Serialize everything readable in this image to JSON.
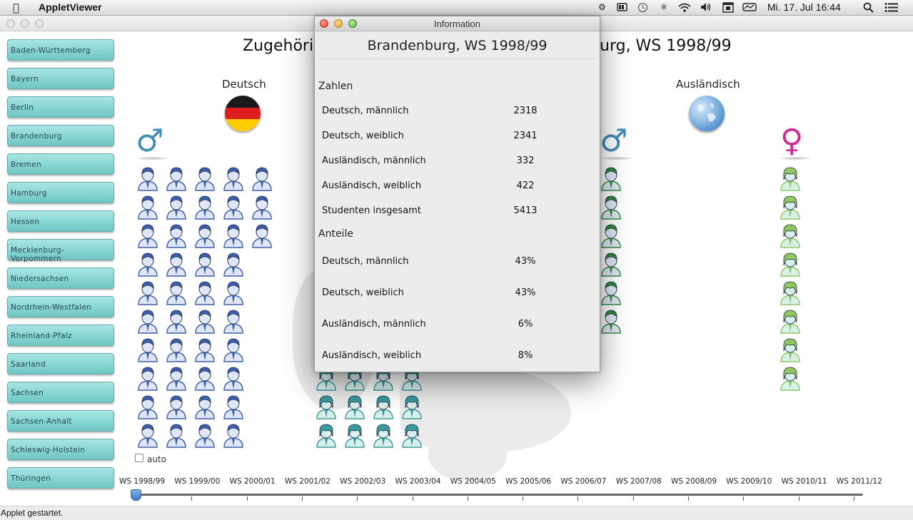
{
  "menubar": {
    "app_name": "AppletViewer",
    "clock": "Mi. 17. Jul  16:44"
  },
  "sidebar": {
    "items": [
      {
        "label": "Baden-Württemberg"
      },
      {
        "label": "Bayern"
      },
      {
        "label": "Berlin"
      },
      {
        "label": "Brandenburg"
      },
      {
        "label": "Bremen"
      },
      {
        "label": "Hamburg"
      },
      {
        "label": "Hessen"
      },
      {
        "label": "Mecklenburg-Vorpommern"
      },
      {
        "label": "Niedersachsen"
      },
      {
        "label": "Nordrhein-Westfalen"
      },
      {
        "label": "Rheinland-Pfalz"
      },
      {
        "label": "Saarland"
      },
      {
        "label": "Sachsen"
      },
      {
        "label": "Sachsen-Anhalt"
      },
      {
        "label": "Schleswig-Holstein"
      },
      {
        "label": "Thüringen"
      }
    ]
  },
  "main": {
    "title_left": "Zugehörig",
    "title_right": "urg, WS 1998/99",
    "col_deutsch": "Deutsch",
    "col_auslaendisch": "Ausländisch",
    "auto_label": "auto",
    "colors": {
      "de_male": "#3d5fae",
      "de_female": "#3a9a9c",
      "aus_male": "#2e8a3a",
      "aus_female": "#8fc860"
    }
  },
  "timeline": {
    "years": [
      "WS 1998/99",
      "WS 1999/00",
      "WS 2000/01",
      "WS 2001/02",
      "WS 2002/03",
      "WS 2003/04",
      "WS 2004/05",
      "WS 2005/06",
      "WS 2006/07",
      "WS 2007/08",
      "WS 2008/09",
      "WS 2009/10",
      "WS 2010/11",
      "WS 2011/12"
    ],
    "selected": "WS 1998/99"
  },
  "status": "Applet gestartet.",
  "dialog": {
    "title": "Information",
    "heading": "Brandenburg, WS 1998/99",
    "section_numbers": "Zahlen",
    "section_shares": "Anteile",
    "numbers": [
      {
        "label": "Deutsch, männlich",
        "value": "2318"
      },
      {
        "label": "Deutsch, weiblich",
        "value": "2341"
      },
      {
        "label": "Ausländisch, männlich",
        "value": "332"
      },
      {
        "label": "Ausländisch, weiblich",
        "value": "422"
      },
      {
        "label": "Studenten insgesamt",
        "value": "5413"
      }
    ],
    "shares": [
      {
        "label": "Deutsch, männlich",
        "value": "43%"
      },
      {
        "label": "Deutsch, weiblich",
        "value": "43%"
      },
      {
        "label": "Ausländisch, männlich",
        "value": "6%"
      },
      {
        "label": "Ausländisch, weiblich",
        "value": "8%"
      }
    ]
  }
}
